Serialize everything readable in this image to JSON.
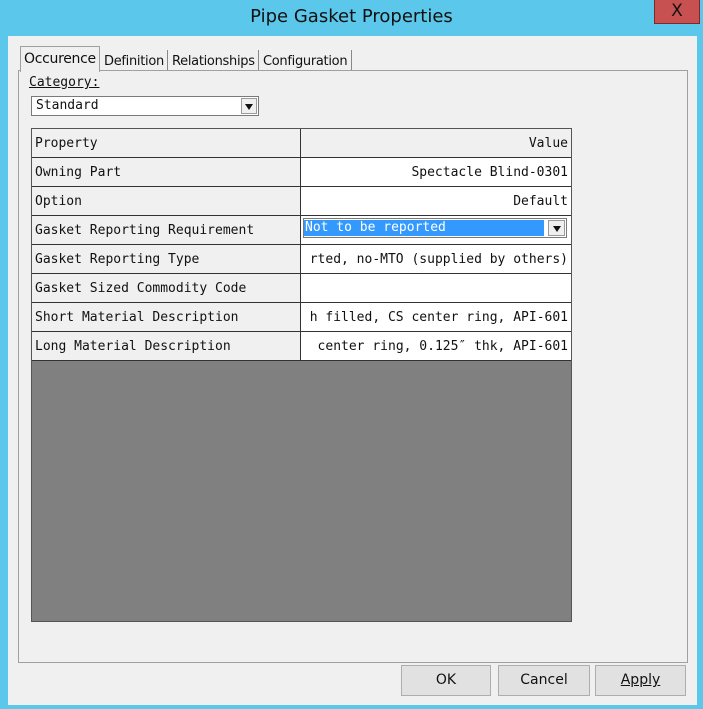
{
  "window": {
    "title": "Pipe Gasket Properties",
    "close_label": "X"
  },
  "tabs": [
    {
      "label": "Occurence"
    },
    {
      "label": "Definition"
    },
    {
      "label": "Relationships"
    },
    {
      "label": "Configuration"
    }
  ],
  "category": {
    "label": "Category:",
    "value": "Standard"
  },
  "grid": {
    "header": {
      "name": "Property",
      "value": "Value"
    },
    "rows": [
      {
        "name": "Owning Part",
        "value": "Spectacle Blind-0301"
      },
      {
        "name": "Option",
        "value": "Default"
      },
      {
        "name": "Gasket Reporting Requirement",
        "value": "Not to be reported"
      },
      {
        "name": "Gasket Reporting Type",
        "value": "rted, no-MTO (supplied by others)"
      },
      {
        "name": "Gasket Sized Commodity Code",
        "value": ""
      },
      {
        "name": "Short Material Description",
        "value": "h filled, CS center ring, API-601"
      },
      {
        "name": "Long Material Description",
        "value": " center ring, 0.125″ thk, API-601"
      }
    ]
  },
  "buttons": {
    "ok": "OK",
    "cancel": "Cancel",
    "apply": "Apply"
  },
  "colors": {
    "title_bar": "#5bc7ea",
    "close_button": "#c75050",
    "selection": "#3399ff",
    "grid_empty": "#808080",
    "dialog_bg": "#f0f0f0"
  }
}
